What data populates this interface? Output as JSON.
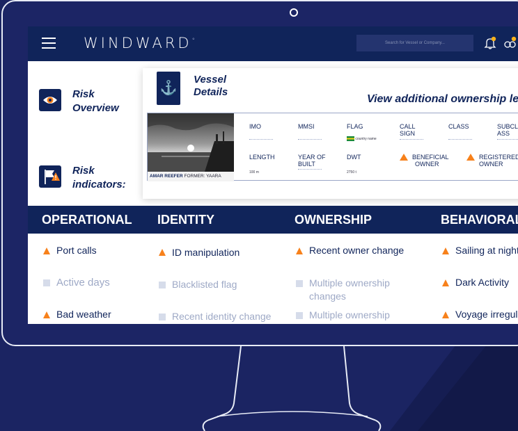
{
  "app": {
    "logo": "WINDWARD",
    "logo_mark": "°",
    "search_placeholder": "Search for Vessel or Company...",
    "icons": [
      "menu-icon",
      "bell-icon",
      "people-icon"
    ]
  },
  "left_panel": {
    "risk_overview_line1": "Risk",
    "risk_overview_line2": "Overview",
    "risk_indicators_line1": "Risk",
    "risk_indicators_line2": "indicators:"
  },
  "vessel": {
    "title_line1": "Vessel",
    "title_line2": "Details",
    "view_link": "View additional ownership lev",
    "caption_name": "AMAR REEFER",
    "caption_former": "FORMER: YAARA",
    "fields": {
      "imo": "IMO",
      "mmsi": "MMSI",
      "flag": "FLAG",
      "flag_value": "country name",
      "call_sign_line1": "CALL",
      "call_sign_line2": "SIGN",
      "class": "CLASS",
      "subclass_line1": "SUBCL",
      "subclass_line2": "ASS",
      "length": "LENGTH",
      "length_value": "100 m",
      "year_built_line1": "YEAR OF",
      "year_built_line2": "BUILT",
      "dwt": "DWT",
      "dwt_value": "2750 t",
      "beneficial_owner_line1": "BENEFICIAL",
      "beneficial_owner_line2": "OWNER",
      "registered_owner_line1": "REGISTERED",
      "registered_owner_line2": "OWNER"
    }
  },
  "categories": [
    {
      "title": "OPERATIONAL",
      "items": [
        {
          "label": "Port calls",
          "status": "alert"
        },
        {
          "label": "Active days",
          "status": "inactive"
        },
        {
          "label": "Bad weather",
          "status": "alert"
        }
      ]
    },
    {
      "title": "IDENTITY",
      "items": [
        {
          "label": "ID manipulation",
          "status": "alert"
        },
        {
          "label": "Blacklisted flag",
          "status": "inactive"
        },
        {
          "label": "Recent identity change",
          "status": "inactive"
        }
      ]
    },
    {
      "title": "OWNERSHIP",
      "items": [
        {
          "label": "Recent owner change",
          "status": "alert"
        },
        {
          "label": "Multiple ownership",
          "label2": "changes",
          "status": "inactive"
        },
        {
          "label": "Multiple ownership",
          "status": "inactive"
        }
      ]
    },
    {
      "title": "BEHAVIORAL",
      "items": [
        {
          "label": "Sailing at night",
          "status": "alert"
        },
        {
          "label": "Dark Activity",
          "status": "alert"
        },
        {
          "label": "Voyage irregula",
          "status": "alert"
        }
      ]
    }
  ],
  "colors": {
    "navy": "#10245a",
    "alert_orange": "#f7811b",
    "inactive_gray": "#9ea9c6",
    "background": "#1b2462"
  }
}
